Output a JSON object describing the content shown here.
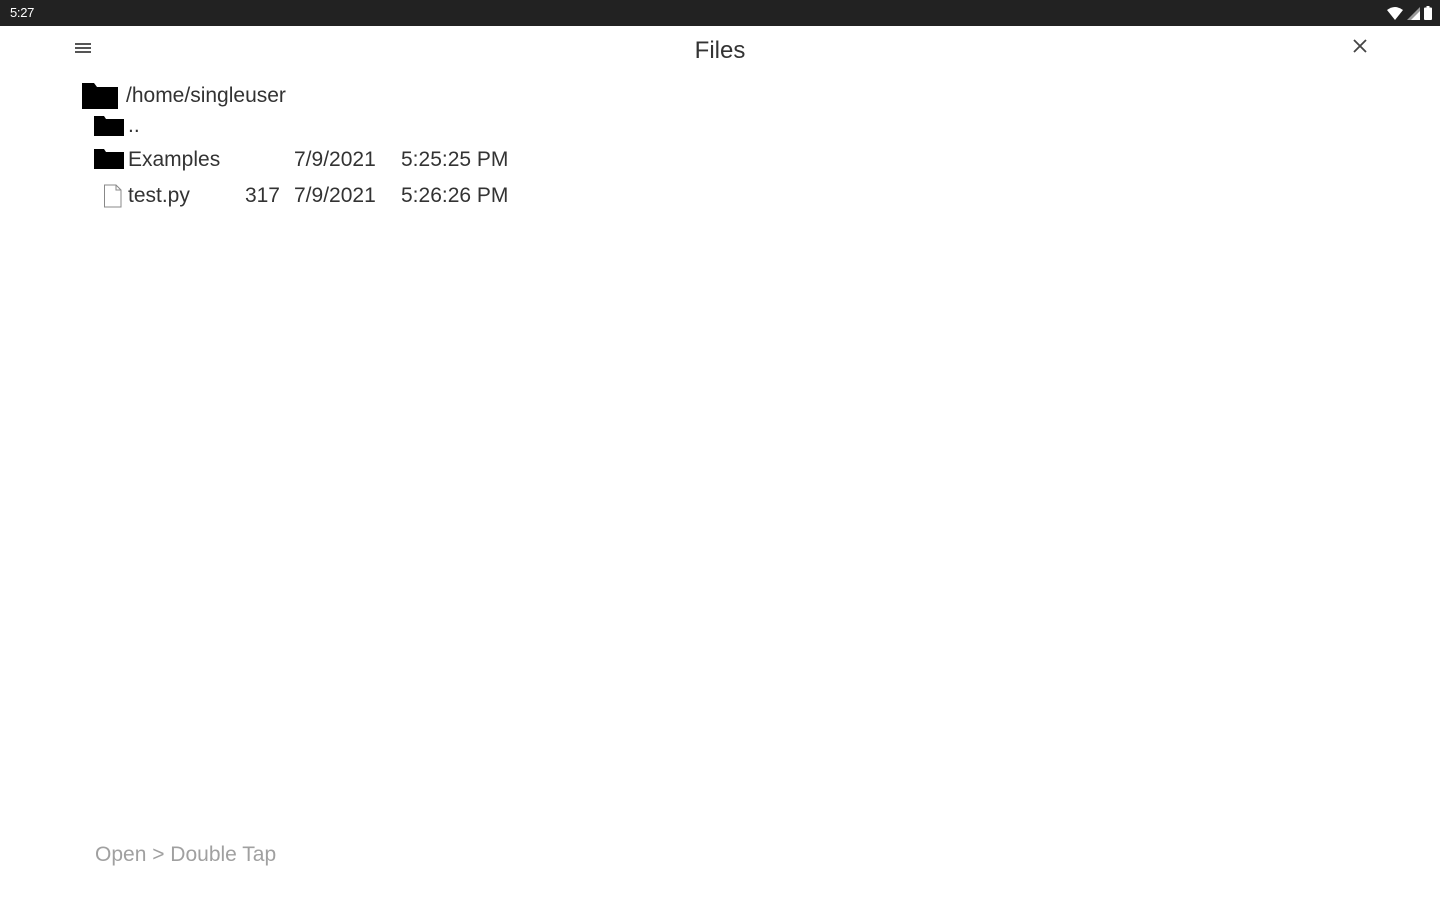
{
  "status_bar": {
    "time": "5:27",
    "icons": [
      "wifi-icon",
      "cell-signal-icon",
      "battery-icon"
    ]
  },
  "header": {
    "title": "Files",
    "menu_icon": "menu-icon",
    "close_icon": "close-icon"
  },
  "listing": {
    "current_path": "/home/singleuser",
    "entries": [
      {
        "type": "folder",
        "name": "..",
        "size": "",
        "date": "",
        "time": ""
      },
      {
        "type": "folder",
        "name": "Examples",
        "size": "",
        "date": "7/9/2021",
        "time": "5:25:25 PM"
      },
      {
        "type": "file",
        "name": "test.py",
        "size": "317",
        "date": "7/9/2021",
        "time": "5:26:26 PM"
      }
    ]
  },
  "footer": {
    "hint": "Open > Double Tap"
  },
  "colors": {
    "status_bar_bg": "#222222",
    "background": "#ffffff",
    "text": "#333333",
    "hint_text": "#a0a0a0"
  }
}
